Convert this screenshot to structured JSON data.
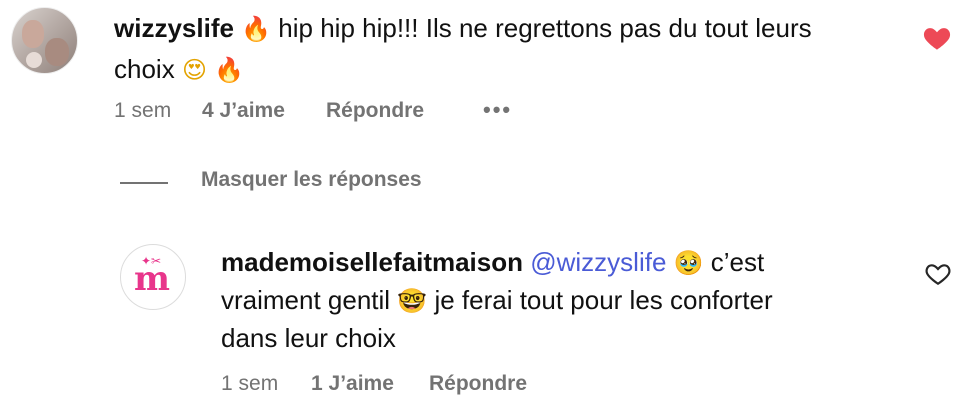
{
  "comment": {
    "username": "wizzyslife",
    "text_1": "hip hip hip!!! Ils ne regrettons pas du tout leurs",
    "text_2": "choix",
    "emoji_fire": "🔥",
    "emoji_heart_eyes": "😍",
    "time": "1 sem",
    "likes": "4 J’aime",
    "reply": "Répondre",
    "more": "•••"
  },
  "replies_toggle": {
    "label": "Masquer les réponses"
  },
  "reply": {
    "username": "mademoisellefaitmaison",
    "mention": "@wizzyslife",
    "emoji_pleading": "🥹",
    "text_1": "c’est",
    "text_2": "vraiment gentil",
    "emoji_nerd": "🤓",
    "text_3": "je ferai tout pour les conforter",
    "text_4": "dans leur choix",
    "time": "1 sem",
    "likes": "1 J’aime",
    "reply": "Répondre",
    "avatar_letter": "m"
  },
  "colors": {
    "like_red": "#ed4956",
    "brand_pink": "#e8358b",
    "mention_blue": "#4a5bd6",
    "meta_gray": "#737373"
  },
  "icons": [
    "heart-filled-icon",
    "heart-outline-icon",
    "more-options-icon"
  ]
}
